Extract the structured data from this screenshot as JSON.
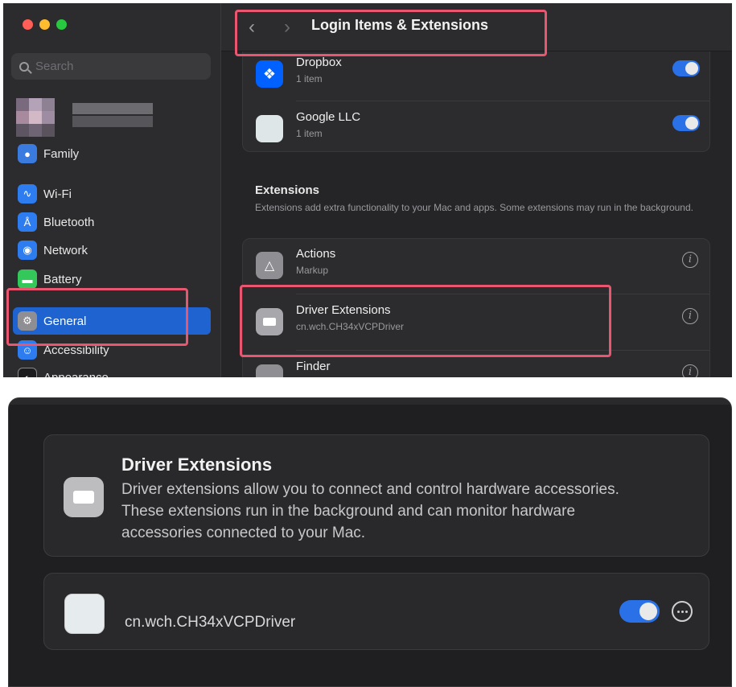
{
  "window": {
    "title": "Login Items & Extensions"
  },
  "sidebar": {
    "search_placeholder": "Search",
    "items": [
      {
        "label": "Family",
        "icon": "family-icon"
      },
      {
        "label": "Wi-Fi",
        "icon": "wifi-icon"
      },
      {
        "label": "Bluetooth",
        "icon": "bluetooth-icon"
      },
      {
        "label": "Network",
        "icon": "network-icon"
      },
      {
        "label": "Battery",
        "icon": "battery-icon"
      },
      {
        "label": "General",
        "icon": "general-icon",
        "active": true
      },
      {
        "label": "Accessibility",
        "icon": "accessibility-icon"
      },
      {
        "label": "Appearance",
        "icon": "appearance-icon"
      }
    ]
  },
  "login_items": [
    {
      "name": "Dropbox",
      "sub": "1 item",
      "enabled": true
    },
    {
      "name": "Google LLC",
      "sub": "1 item",
      "enabled": true
    }
  ],
  "extensions": {
    "title": "Extensions",
    "description": "Extensions add extra functionality to your Mac and apps. Some extensions may run in the background.",
    "items": [
      {
        "name": "Actions",
        "sub": "Markup"
      },
      {
        "name": "Driver Extensions",
        "sub": "cn.wch.CH34xVCPDriver"
      },
      {
        "name": "Finder",
        "sub": ""
      }
    ]
  },
  "driver_panel": {
    "title": "Driver Extensions",
    "description": "Driver extensions allow you to connect and control hardware accessories. These extensions run in the background and can monitor hardware accessories connected to your Mac.",
    "driver_name": "cn.wch.CH34xVCPDriver",
    "enabled": true
  },
  "colors": {
    "accent": "#2a71e8",
    "highlight": "#e8566f",
    "active_item": "#1f63d1"
  }
}
